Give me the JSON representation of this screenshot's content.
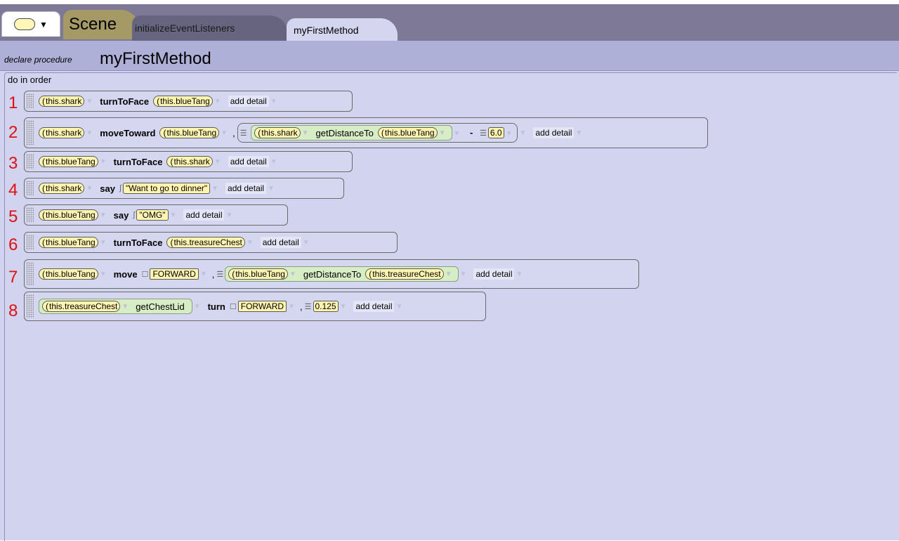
{
  "tabs": {
    "type_selector_arrow": "▼",
    "scene": "Scene",
    "initialize": "initializeEventListeners",
    "current": "myFirstMethod"
  },
  "header": {
    "decl_label": "declare procedure",
    "method_name": "myFirstMethod"
  },
  "body": {
    "do_in_order": "do in order"
  },
  "statements": [
    {
      "num": "1",
      "target": "this.shark",
      "method": "turnToFace",
      "arg": "this.blueTang",
      "detail": "add detail"
    },
    {
      "num": "2",
      "target": "this.shark",
      "method": "moveToward",
      "arg": "this.blueTang",
      "func_target": "this.shark",
      "func_method": "getDistanceTo",
      "func_arg": "this.blueTang",
      "minus": "-",
      "value": "6.0",
      "detail": "add detail"
    },
    {
      "num": "3",
      "target": "this.blueTang",
      "method": "turnToFace",
      "arg": "this.shark",
      "detail": "add detail"
    },
    {
      "num": "4",
      "target": "this.shark",
      "method": "say",
      "arg": "\"Want to go to dinner\"",
      "detail": "add detail"
    },
    {
      "num": "5",
      "target": "this.blueTang",
      "method": "say",
      "arg": "\"OMG\"",
      "detail": "add detail"
    },
    {
      "num": "6",
      "target": "this.blueTang",
      "method": "turnToFace",
      "arg": "this.treasureChest",
      "detail": "add detail"
    },
    {
      "num": "7",
      "target": "this.blueTang",
      "method": "move",
      "direction": "FORWARD",
      "func_target": "this.blueTang",
      "func_method": "getDistanceTo",
      "func_arg": "this.treasureChest",
      "detail": "add detail"
    },
    {
      "num": "8",
      "func_target": "this.treasureChest",
      "func_method": "getChestLid",
      "method": "turn",
      "direction": "FORWARD",
      "value": "0.125",
      "detail": "add detail"
    }
  ]
}
